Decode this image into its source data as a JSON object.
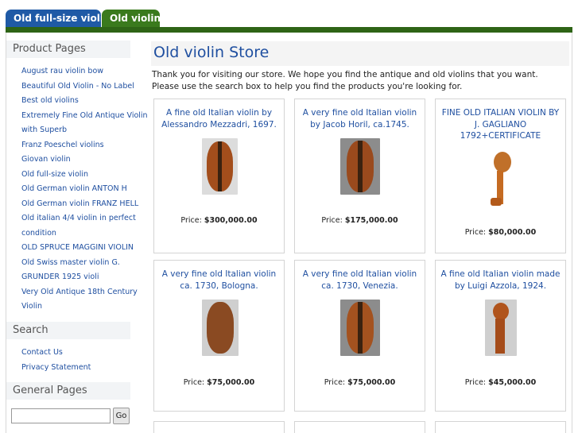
{
  "tabs": [
    {
      "label": "Old full-size violin"
    },
    {
      "label": "Old violin"
    }
  ],
  "sidebar": {
    "product_heading": "Product Pages",
    "product_links": [
      "August rau violin bow",
      "Beautiful Old Violin - No Label",
      "Best old violins",
      "Extremely Fine Old Antique Violin",
      "with Superb",
      "Franz Poeschel violins",
      "Giovan violin",
      "Old full-size violin",
      "Old German violin ANTON H",
      "Old German violin FRANZ HELL",
      "Old italian 4/4 violin in perfect",
      "condition",
      "OLD SPRUCE MAGGINI VIOLIN",
      "Old Swiss master violin G.",
      "GRUNDER 1925 violi",
      "Very Old Antique 18th Century",
      "Violin"
    ],
    "search_heading": "Search",
    "search_links": [
      "Contact Us",
      "Privacy Statement"
    ],
    "general_heading": "General Pages",
    "search_value": "",
    "go_label": "Go"
  },
  "main": {
    "title": "Old violin Store",
    "intro": "Thank you for visiting our store. We hope you find the antique and old violins that you want. Please use the search box to help you find the products you're looking for.",
    "price_prefix": "Price:",
    "products": [
      {
        "title": "A fine old Italian violin by Alessandro Mezzadri, 1697.",
        "price": "$300,000.00"
      },
      {
        "title": "A very fine old Italian violin by Jacob Horil, ca.1745.",
        "price": "$175,000.00"
      },
      {
        "title": "FINE OLD ITALIAN VIOLIN BY J. GAGLIANO 1792+CERTIFICATE",
        "price": "$80,000.00"
      },
      {
        "title": "A very fine old Italian violin ca. 1730, Bologna.",
        "price": "$75,000.00"
      },
      {
        "title": "A very fine old Italian violin ca. 1730, Venezia.",
        "price": "$75,000.00"
      },
      {
        "title": "A fine old Italian violin made by Luigi Azzola, 1924.",
        "price": "$45,000.00"
      }
    ]
  }
}
